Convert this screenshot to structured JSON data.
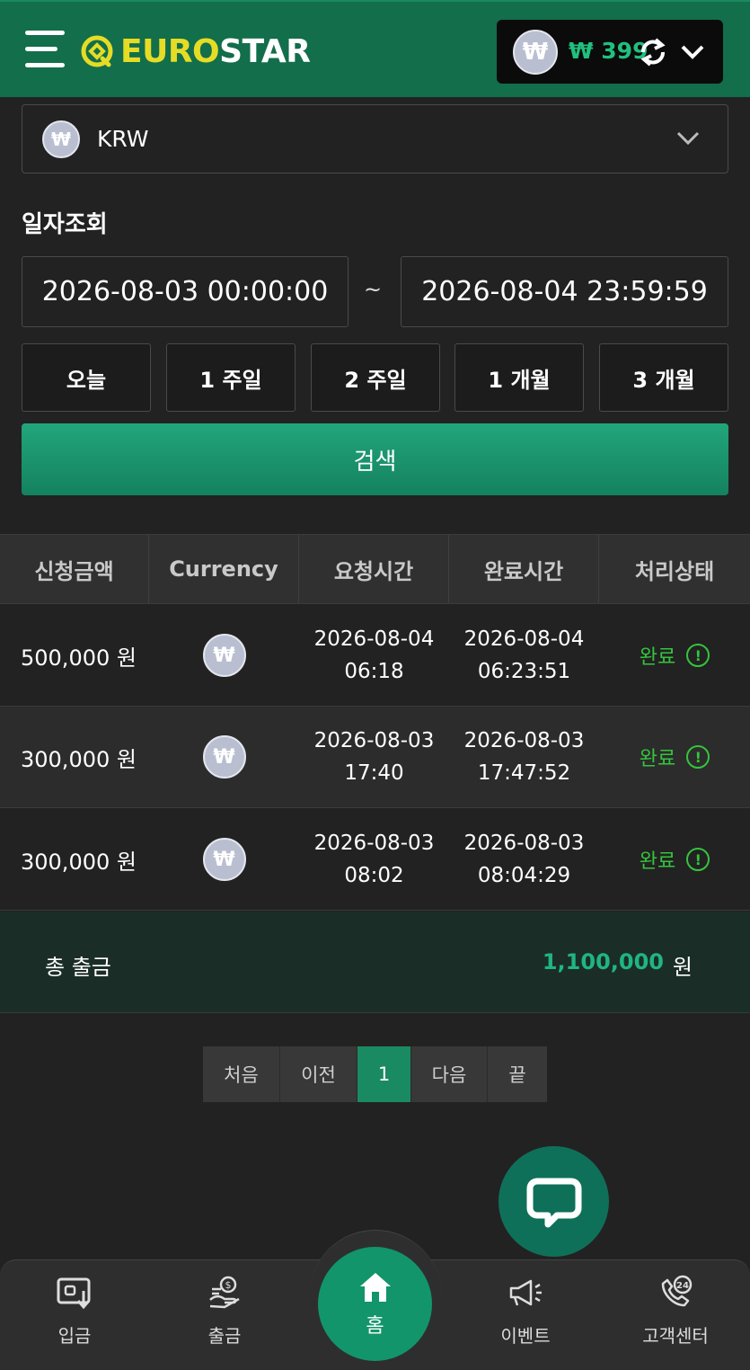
{
  "header": {
    "logo_euro": "EURO",
    "logo_star": "STAR",
    "wallet": {
      "coin_symbol": "₩",
      "balance": "₩ 399"
    }
  },
  "filter": {
    "currency": {
      "coin_symbol": "₩",
      "label": "KRW"
    },
    "date_title": "일자조회",
    "date_from": "2026-08-03 00:00:00",
    "date_separator": "~",
    "date_to": "2026-08-04 23:59:59",
    "ranges": [
      "오늘",
      "1 주일",
      "2 주일",
      "1 개월",
      "3 개월"
    ],
    "search_label": "검색"
  },
  "table": {
    "headers": [
      "신청금액",
      "Currency",
      "요청시간",
      "완료시간",
      "처리상태"
    ],
    "rows": [
      {
        "amount": "500,000 원",
        "coin_symbol": "₩",
        "req_date": "2026-08-04",
        "req_time": "06:18",
        "done_date": "2026-08-04",
        "done_time": "06:23:51",
        "status": "완료"
      },
      {
        "amount": "300,000 원",
        "coin_symbol": "₩",
        "req_date": "2026-08-03",
        "req_time": "17:40",
        "done_date": "2026-08-03",
        "done_time": "17:47:52",
        "status": "완료"
      },
      {
        "amount": "300,000 원",
        "coin_symbol": "₩",
        "req_date": "2026-08-03",
        "req_time": "08:02",
        "done_date": "2026-08-03",
        "done_time": "08:04:29",
        "status": "완료"
      }
    ],
    "status_icon_glyph": "!"
  },
  "total": {
    "label": "총 출금",
    "value": "1,100,000",
    "unit": "원"
  },
  "pagination": {
    "first": "처음",
    "prev": "이전",
    "current": "1",
    "next": "다음",
    "last": "끝"
  },
  "bottom_nav": {
    "deposit": "입금",
    "withdraw": "출금",
    "home": "홈",
    "event": "이벤트",
    "support": "고객센터"
  },
  "colors": {
    "header_bg": "#126e4b",
    "accent": "#1a8a63",
    "logo_yellow": "#e6dc25",
    "status_green": "#35c43d",
    "total_green": "#20b583"
  },
  "icons": {
    "menu": "hamburger-menu-icon",
    "refresh": "refresh-icon",
    "chat": "chat-bubble-icon",
    "deposit": "wallet-in-icon",
    "withdraw": "coins-hand-icon",
    "home": "house-icon",
    "event": "megaphone-icon",
    "support": "phone-24-icon"
  }
}
